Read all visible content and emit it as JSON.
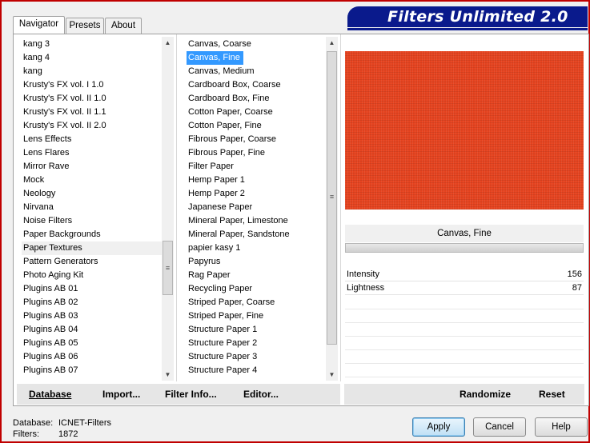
{
  "tabs": [
    {
      "label": "Navigator",
      "active": true
    },
    {
      "label": "Presets",
      "active": false
    },
    {
      "label": "About",
      "active": false
    }
  ],
  "banner": {
    "title": "Filters Unlimited 2.0"
  },
  "categories": {
    "items": [
      "kang 3",
      "kang 4",
      "kang",
      "Krusty's FX vol. I 1.0",
      "Krusty's FX vol. II 1.0",
      "Krusty's FX vol. II 1.1",
      "Krusty's FX vol. II 2.0",
      "Lens Effects",
      "Lens Flares",
      "Mirror Rave",
      "Mock",
      "Neology",
      "Nirvana",
      "Noise Filters",
      "Paper Backgrounds",
      "Paper Textures",
      "Pattern Generators",
      "Photo Aging Kit",
      "Plugins AB 01",
      "Plugins AB 02",
      "Plugins AB 03",
      "Plugins AB 04",
      "Plugins AB 05",
      "Plugins AB 06",
      "Plugins AB 07"
    ],
    "selected": "Paper Textures"
  },
  "filters": {
    "items": [
      "Canvas, Coarse",
      "Canvas, Fine",
      "Canvas, Medium",
      "Cardboard Box, Coarse",
      "Cardboard Box, Fine",
      "Cotton Paper, Coarse",
      "Cotton Paper, Fine",
      "Fibrous Paper, Coarse",
      "Fibrous Paper, Fine",
      "Filter Paper",
      "Hemp Paper 1",
      "Hemp Paper 2",
      "Japanese Paper",
      "Mineral Paper, Limestone",
      "Mineral Paper, Sandstone",
      "papier kasy 1",
      "Papyrus",
      "Rag Paper",
      "Recycling Paper",
      "Striped Paper, Coarse",
      "Striped Paper, Fine",
      "Structure Paper 1",
      "Structure Paper 2",
      "Structure Paper 3",
      "Structure Paper 4"
    ],
    "selected": "Canvas, Fine"
  },
  "left_toolbar": {
    "database": "Database",
    "import": "Import...",
    "filter_info": "Filter Info...",
    "editor": "Editor..."
  },
  "preview": {
    "color": "#e5431f",
    "filter_name": "Canvas, Fine"
  },
  "parameters": [
    {
      "label": "Intensity",
      "value": "156"
    },
    {
      "label": "Lightness",
      "value": "87"
    }
  ],
  "right_toolbar": {
    "randomize": "Randomize",
    "reset": "Reset"
  },
  "status": {
    "database_label": "Database:",
    "database_value": "ICNET-Filters",
    "filters_label": "Filters:",
    "filters_value": "1872"
  },
  "buttons": {
    "apply": "Apply",
    "cancel": "Cancel",
    "help": "Help"
  }
}
